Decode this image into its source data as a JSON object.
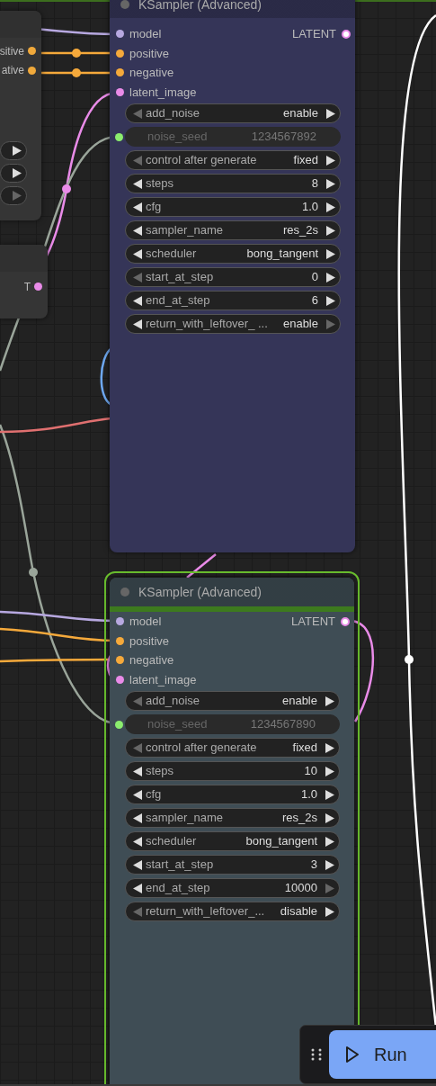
{
  "left_nodes": [
    {
      "outputs": [
        {
          "label": "sitive",
          "color": "#f0a93b"
        },
        {
          "label": "ative",
          "color": "#f0a93b"
        }
      ],
      "widgets": [
        {
          "right_enabled": true
        },
        {
          "right_enabled": true
        },
        {
          "right_enabled": false
        }
      ]
    },
    {
      "outputs": [
        {
          "label": "T",
          "color": "#e98be8"
        }
      ]
    }
  ],
  "nodes": [
    {
      "title": "KSampler (Advanced)",
      "selected": false,
      "color": "#353558",
      "inputs": [
        {
          "label": "model",
          "color": "#b7a8e0"
        },
        {
          "label": "positive",
          "color": "#f5a93b"
        },
        {
          "label": "negative",
          "color": "#f5a93b"
        },
        {
          "label": "latent_image",
          "color": "#e98be8"
        }
      ],
      "output": {
        "label": "LATENT",
        "color": "#e98be8"
      },
      "widgets": [
        {
          "kind": "value",
          "label": "add_noise",
          "value": "enable",
          "left_enabled": false,
          "right_enabled": true
        },
        {
          "kind": "input",
          "label": "noise_seed",
          "value": "1234567892",
          "color": "#8bed6e"
        },
        {
          "kind": "value",
          "label": "control after generate",
          "value": "fixed",
          "left_enabled": false,
          "right_enabled": true
        },
        {
          "kind": "value",
          "label": "steps",
          "value": "8",
          "left_enabled": true,
          "right_enabled": true
        },
        {
          "kind": "value",
          "label": "cfg",
          "value": "1.0",
          "left_enabled": true,
          "right_enabled": true
        },
        {
          "kind": "value",
          "label": "sampler_name",
          "value": "res_2s",
          "left_enabled": true,
          "right_enabled": true
        },
        {
          "kind": "value",
          "label": "scheduler",
          "value": "bong_tangent",
          "left_enabled": true,
          "right_enabled": true
        },
        {
          "kind": "value",
          "label": "start_at_step",
          "value": "0",
          "left_enabled": false,
          "right_enabled": true
        },
        {
          "kind": "value",
          "label": "end_at_step",
          "value": "6",
          "left_enabled": true,
          "right_enabled": true
        },
        {
          "kind": "value",
          "label": "return_with_leftover_ ...",
          "value": "enable",
          "left_enabled": true,
          "right_enabled": false
        }
      ]
    },
    {
      "title": "KSampler (Advanced)",
      "selected": true,
      "color": "#3f4d55",
      "inputs": [
        {
          "label": "model",
          "color": "#b7a8e0"
        },
        {
          "label": "positive",
          "color": "#f5a93b"
        },
        {
          "label": "negative",
          "color": "#f5a93b"
        },
        {
          "label": "latent_image",
          "color": "#e98be8"
        }
      ],
      "output": {
        "label": "LATENT",
        "color": "#e98be8"
      },
      "widgets": [
        {
          "kind": "value",
          "label": "add_noise",
          "value": "enable",
          "left_enabled": false,
          "right_enabled": true
        },
        {
          "kind": "input",
          "label": "noise_seed",
          "value": "1234567890",
          "color": "#8bed6e"
        },
        {
          "kind": "value",
          "label": "control after generate",
          "value": "fixed",
          "left_enabled": false,
          "right_enabled": true
        },
        {
          "kind": "value",
          "label": "steps",
          "value": "10",
          "left_enabled": true,
          "right_enabled": true
        },
        {
          "kind": "value",
          "label": "cfg",
          "value": "1.0",
          "left_enabled": true,
          "right_enabled": true
        },
        {
          "kind": "value",
          "label": "sampler_name",
          "value": "res_2s",
          "left_enabled": true,
          "right_enabled": true
        },
        {
          "kind": "value",
          "label": "scheduler",
          "value": "bong_tangent",
          "left_enabled": true,
          "right_enabled": true
        },
        {
          "kind": "value",
          "label": "start_at_step",
          "value": "3",
          "left_enabled": true,
          "right_enabled": true
        },
        {
          "kind": "value",
          "label": "end_at_step",
          "value": "10000",
          "left_enabled": true,
          "right_enabled": false
        },
        {
          "kind": "value",
          "label": "return_with_leftover_...",
          "value": "disable",
          "left_enabled": false,
          "right_enabled": true
        }
      ]
    }
  ],
  "run_panel": {
    "button": "Run"
  }
}
